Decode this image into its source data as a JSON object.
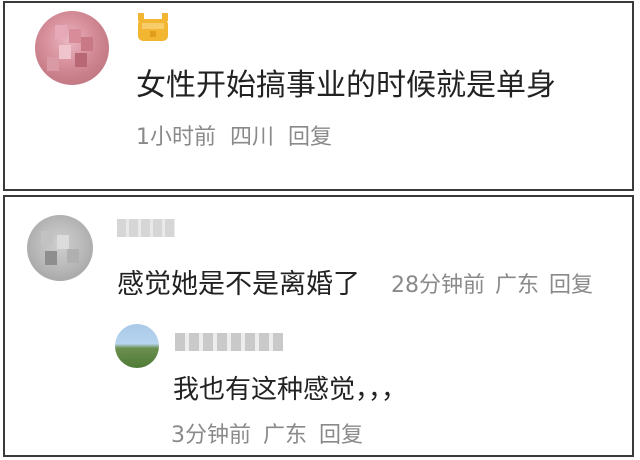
{
  "comment_top": {
    "text": "女性开始搞事业的时候就是单身",
    "time": "1小时前",
    "location": "四川",
    "reply_label": "回复",
    "accent_color": "#f2b632"
  },
  "comment_second": {
    "text": "感觉她是不是离婚了",
    "time": "28分钟前",
    "location": "广东",
    "reply_label": "回复"
  },
  "comment_reply": {
    "text": "我也有这种感觉，，，",
    "time": "3分钟前",
    "location": "广东",
    "reply_label": "回复"
  }
}
